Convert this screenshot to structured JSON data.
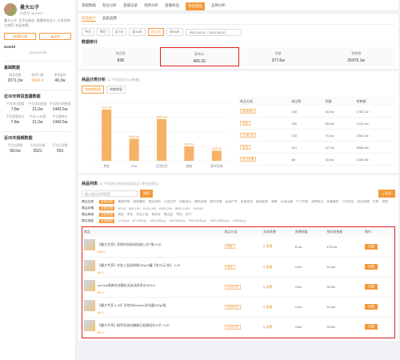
{
  "profile": {
    "name": "曼大公子",
    "sub": "抖音号: qin1993",
    "desc": "曼大公子, 全平台粉丝, 直播带货达人, 分享好物与穿搭, 欢迎来撩。",
    "follow_label": "收藏企播",
    "compare_label": "监控",
    "uid_label": "UserId",
    "uid_value": "1404126936"
  },
  "fans": {
    "title": "基础数据",
    "items": [
      {
        "k": "粉丝总数",
        "v": "2071.3w"
      },
      {
        "k": "带货口碑",
        "v": "5604.4"
      },
      {
        "k": "带货级别",
        "v": "49.3w"
      }
    ]
  },
  "live30": {
    "title": "近30天带货直播数据",
    "items": [
      {
        "k": "平均场均观看",
        "v": "7.8w"
      },
      {
        "k": "平均场均销量",
        "v": "21.0w"
      },
      {
        "k": "平均场均销售额",
        "v": "1443.5w"
      },
      {
        "k": "平均观看时长",
        "v": "7.8w"
      },
      {
        "k": "平均UV价值",
        "v": "21.0w"
      },
      {
        "k": "平均客单价",
        "v": "1443.5w"
      }
    ]
  },
  "video30": {
    "title": "近30天视频数据",
    "items": [
      {
        "k": "平均点赞数",
        "v": "58.0w"
      },
      {
        "k": "平均评论数",
        "v": "3521"
      },
      {
        "k": "平均分享数",
        "v": "553"
      }
    ]
  },
  "topnav": [
    "基础数据",
    "粉丝分析",
    "直播记录",
    "视频分析",
    "直播商品",
    "带货商品",
    "品牌分析"
  ],
  "topnav_active": 5,
  "subtabs": [
    "商品统计",
    "品类品牌"
  ],
  "date_chips": [
    "今日",
    "昨日",
    "近7天",
    "近15天",
    "近30天",
    "近90天"
  ],
  "date_range": "2021-04-11 ~ 2021-05-10",
  "overview": {
    "title": "数据统计",
    "kpis": [
      {
        "k": "商品数",
        "v": "838"
      },
      {
        "k": "客单价",
        "v": "¥65.32"
      },
      {
        "k": "销量",
        "v": "377.6w"
      },
      {
        "k": "销售额",
        "v": "25975.1w"
      }
    ]
  },
  "category": {
    "title": "商品分类分析",
    "note": "(以下分类仅为Top5数据)",
    "chips": [
      "销售额数据",
      "销售数量"
    ],
    "headers": [
      "商品分类",
      "商品数",
      "销量",
      "销售额"
    ],
    "rows": [
      {
        "cat": "服装箱包",
        "num": "140",
        "sales": "63.1w",
        "amount": "1783.7w"
      },
      {
        "cat": "美妆",
        "num": "252",
        "sales": "89.5w",
        "amount": "7124.4w"
      },
      {
        "cat": "日用百货",
        "num": "120",
        "sales": "70.2w",
        "amount": "2002.4w"
      },
      {
        "cat": "食品",
        "num": "113",
        "sales": "42.7w",
        "amount": "3066.6w"
      },
      {
        "cat": "图书音像",
        "num": "88",
        "sales": "45.6w",
        "amount": "1406.9w"
      }
    ]
  },
  "chart_data": {
    "type": "bar",
    "categories": [
      "美妆",
      "IPM",
      "日用百货",
      "服装",
      "图书音像"
    ],
    "values": [
      7124.4,
      3066.6,
      5800.0,
      2002.4,
      1406.9
    ],
    "data_labels": [
      "7124.4w",
      "3066.6w",
      "5800.0w",
      "2002.4w",
      "1406.9w"
    ],
    "ylim": [
      0,
      8000
    ],
    "title": "",
    "xlabel": "",
    "ylabel": ""
  },
  "product_list": {
    "title": "商品列表",
    "note": "(以下列表仅为所选时间段该达人带货的商品)",
    "search_placeholder": "输入商品名称搜索",
    "search_btn": "搜索",
    "export_btn": "导出",
    "filters": [
      {
        "label": "商品分类",
        "options": [
          "全部分类",
          "美妆护肤",
          "服装箱包",
          "食品饮料",
          "日用百货",
          "母婴用品",
          "数码家电",
          "图书音像",
          "运动户外",
          "家居家纺",
          "珠宝配饰",
          "鞋靴",
          "玩具乐器",
          "个人护理",
          "宠物用品",
          "家装建材",
          "汽车用品",
          "医药保健",
          "生鲜",
          "其他"
        ]
      },
      {
        "label": "商品价格",
        "options": [
          "全部价格",
          "¥0-50",
          "¥50-100",
          "¥100-300",
          "¥300-500",
          "¥500-1000",
          ">¥1000"
        ]
      },
      {
        "label": "商品来源",
        "options": [
          "全部来源",
          "淘宝",
          "京东",
          "抖音小店",
          "拼多多",
          "唯品会",
          "考拉",
          "苏宁"
        ]
      },
      {
        "label": "商品佣金",
        "options": [
          "全部佣金",
          "1-10(元)",
          "10-100(元)",
          "100-300(元)",
          "300-500(元)",
          "500-1000(元)",
          "1000-5000(元)",
          ">5000(元)"
        ]
      }
    ],
    "headers": [
      "商品",
      "商品分类",
      "关联直播",
      "直播销量",
      "预估销售额",
      "操作"
    ],
    "rows": [
      {
        "name": "【曼大专享】男装时尚休闲短袖上衣T恤 4.20",
        "price": "¥69.0",
        "cat": "服装",
        "live": "2",
        "rank": "直播",
        "sales": "8.1w",
        "amount": "479.2w",
        "op": "详情"
      },
      {
        "name": "【曼大专享】合金三层奶粉格100g*6罐【仅20元/包】 4.20",
        "price": "¥0.0",
        "cat": "食品",
        "live": "1",
        "rank": "直播",
        "sales": "4.9w",
        "amount": "40.0w",
        "op": "详情"
      },
      {
        "name": "yunhuli清爽控油蓬松无硅油洗发水500ml",
        "price": "¥0.0",
        "cat": "日用百货",
        "live": "1",
        "rank": "直播",
        "sales": "4.5w",
        "amount": "30.3w",
        "op": "详情"
      },
      {
        "name": "【曼大专享 4.20】好吃的freeplus沐浴露250g*瓶",
        "price": "¥0.0",
        "cat": "日用百货",
        "live": "1",
        "rank": "直播",
        "sales": "4.3w",
        "amount": "40.0w",
        "op": "详情"
      },
      {
        "name": "【曼大专享】植萃优选抗糖美白面膜组合10片 4.20",
        "price": "¥0.0",
        "cat": "日用百货",
        "live": "1",
        "rank": "直播",
        "sales": "3.8w",
        "amount": "29.0w",
        "op": "详情"
      }
    ]
  }
}
